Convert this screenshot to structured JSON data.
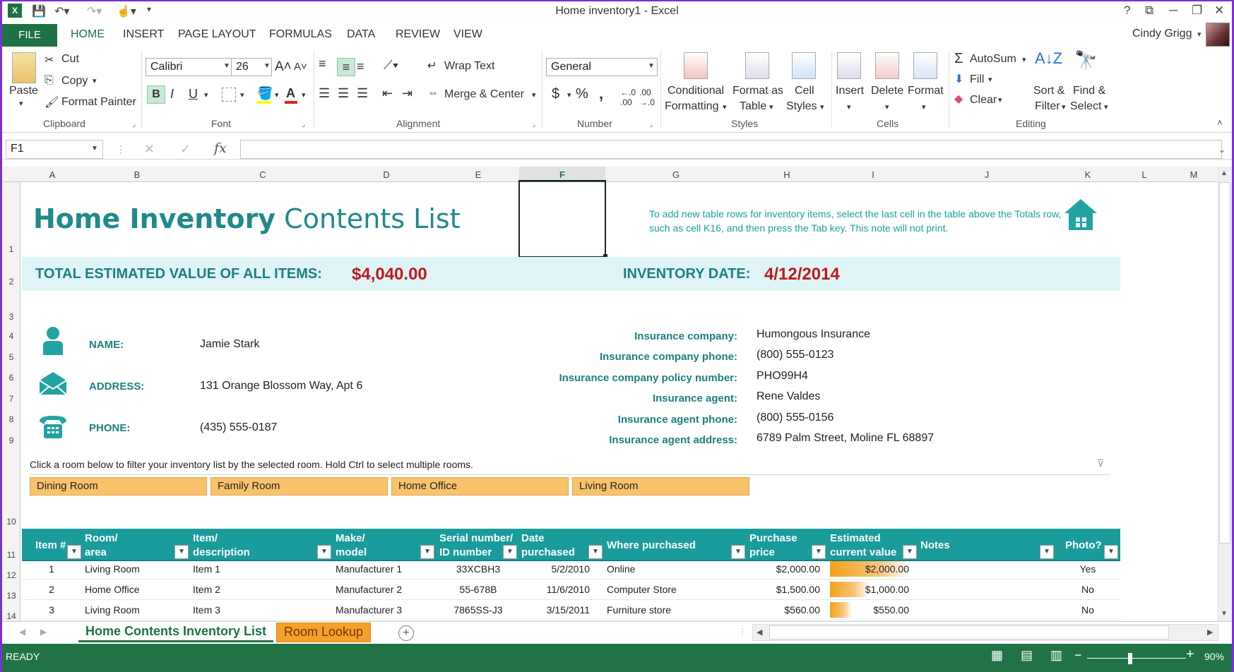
{
  "window": {
    "title": "Home inventory1 - Excel",
    "help": "?",
    "restore_ribbon": "⧉",
    "minimize": "─",
    "maximize": "❐",
    "close": "✕"
  },
  "ribbon_tabs": [
    "FILE",
    "HOME",
    "INSERT",
    "PAGE LAYOUT",
    "FORMULAS",
    "DATA",
    "REVIEW",
    "VIEW"
  ],
  "user": {
    "name": "Cindy Grigg"
  },
  "clipboard": {
    "paste": "Paste",
    "cut": "Cut",
    "copy": "Copy",
    "format_painter": "Format Painter",
    "group": "Clipboard"
  },
  "font": {
    "name": "Calibri",
    "size": "26",
    "bold": "B",
    "italic": "I",
    "underline": "U",
    "group": "Font"
  },
  "alignment": {
    "wrap": "Wrap Text",
    "merge": "Merge & Center",
    "group": "Alignment"
  },
  "number": {
    "format": "General",
    "currency": "$",
    "percent": "%",
    "comma": ",",
    "group": "Number",
    "inc_dec": ".00"
  },
  "styles": {
    "conditional": "Conditional",
    "conditional2": "Formatting",
    "format_table": "Format as",
    "format_table2": "Table",
    "cell_styles": "Cell",
    "cell_styles2": "Styles",
    "group": "Styles"
  },
  "cells": {
    "insert": "Insert",
    "delete": "Delete",
    "format": "Format",
    "group": "Cells"
  },
  "editing": {
    "autosum": "AutoSum",
    "fill": "Fill",
    "clear": "Clear",
    "sort": "Sort &",
    "sort2": "Filter",
    "find": "Find &",
    "find2": "Select",
    "group": "Editing"
  },
  "formula_bar": {
    "name_box": "F1",
    "fx": "fx"
  },
  "columns": [
    "A",
    "B",
    "C",
    "D",
    "E",
    "F",
    "G",
    "H",
    "I",
    "J",
    "K",
    "L",
    "M"
  ],
  "rows": [
    "1",
    "2",
    "3",
    "4",
    "5",
    "6",
    "7",
    "8",
    "9",
    "10",
    "11",
    "12",
    "13",
    "14"
  ],
  "sheet": {
    "title_bold": "Home Inventory",
    "title_rest": " Contents List",
    "note": "To add new table rows for inventory items, select the last cell in the table above the Totals row, such as cell K16, and then press the Tab key. This note will not print.",
    "total_label": "TOTAL ESTIMATED VALUE OF ALL ITEMS:",
    "total_value": "$4,040.00",
    "date_label": "INVENTORY DATE:",
    "date_value": "4/12/2014",
    "name_label": "NAME:",
    "name_value": "Jamie Stark",
    "address_label": "ADDRESS:",
    "address_value": "131 Orange Blossom Way, Apt 6",
    "phone_label": "PHONE:",
    "phone_value": "(435) 555-0187",
    "insurance": [
      {
        "label": "Insurance company:",
        "value": "Humongous Insurance"
      },
      {
        "label": "Insurance company phone:",
        "value": "(800) 555-0123"
      },
      {
        "label": "Insurance company policy number:",
        "value": "PHO99H4"
      },
      {
        "label": "Insurance agent:",
        "value": "Rene Valdes"
      },
      {
        "label": "Insurance agent phone:",
        "value": "(800) 555-0156"
      },
      {
        "label": "Insurance agent address:",
        "value": "6789 Palm Street, Moline FL 68897"
      }
    ],
    "filter_hint": "Click a room below to filter your inventory list by the selected room. Hold Ctrl to select multiple rooms.",
    "slicers": [
      "Dining Room",
      "Family Room",
      "Home Office",
      "Living Room"
    ]
  },
  "table": {
    "headers": [
      {
        "l1": "Item #",
        "l2": ""
      },
      {
        "l1": "Room/",
        "l2": "area"
      },
      {
        "l1": "Item/",
        "l2": "description"
      },
      {
        "l1": "Make/",
        "l2": "model"
      },
      {
        "l1": "Serial number/",
        "l2": "ID number"
      },
      {
        "l1": "Date",
        "l2": "purchased"
      },
      {
        "l1": "Where purchased",
        "l2": ""
      },
      {
        "l1": "Purchase",
        "l2": "price"
      },
      {
        "l1": "Estimated",
        "l2": "current value"
      },
      {
        "l1": "Notes",
        "l2": ""
      },
      {
        "l1": "Photo?",
        "l2": ""
      }
    ],
    "rows": [
      {
        "item": "1",
        "room": "Living Room",
        "desc": "Item 1",
        "make": "Manufacturer 1",
        "serial": "33XCBH3",
        "date": "5/2/2010",
        "where": "Online",
        "price": "$2,000.00",
        "value": "$2,000.00",
        "photo": "Yes"
      },
      {
        "item": "2",
        "room": "Home Office",
        "desc": "Item 2",
        "make": "Manufacturer 2",
        "serial": "55-678B",
        "date": "11/6/2010",
        "where": "Computer Store",
        "price": "$1,500.00",
        "value": "$1,000.00",
        "photo": "No"
      },
      {
        "item": "3",
        "room": "Living Room",
        "desc": "Item 3",
        "make": "Manufacturer 3",
        "serial": "7865SS-J3",
        "date": "3/15/2011",
        "where": "Furniture store",
        "price": "$560.00",
        "value": "$550.00",
        "photo": "No"
      }
    ],
    "value_fraction": [
      1.0,
      0.5,
      0.275
    ]
  },
  "sheet_tabs": [
    "Home Contents Inventory List",
    "Room Lookup"
  ],
  "status": {
    "ready": "READY",
    "zoom": "90%"
  },
  "colors": {
    "excel_green": "#217346",
    "teal": "#1a9c9c",
    "total_red": "#c0181c",
    "slicer": "#f9c36b"
  }
}
